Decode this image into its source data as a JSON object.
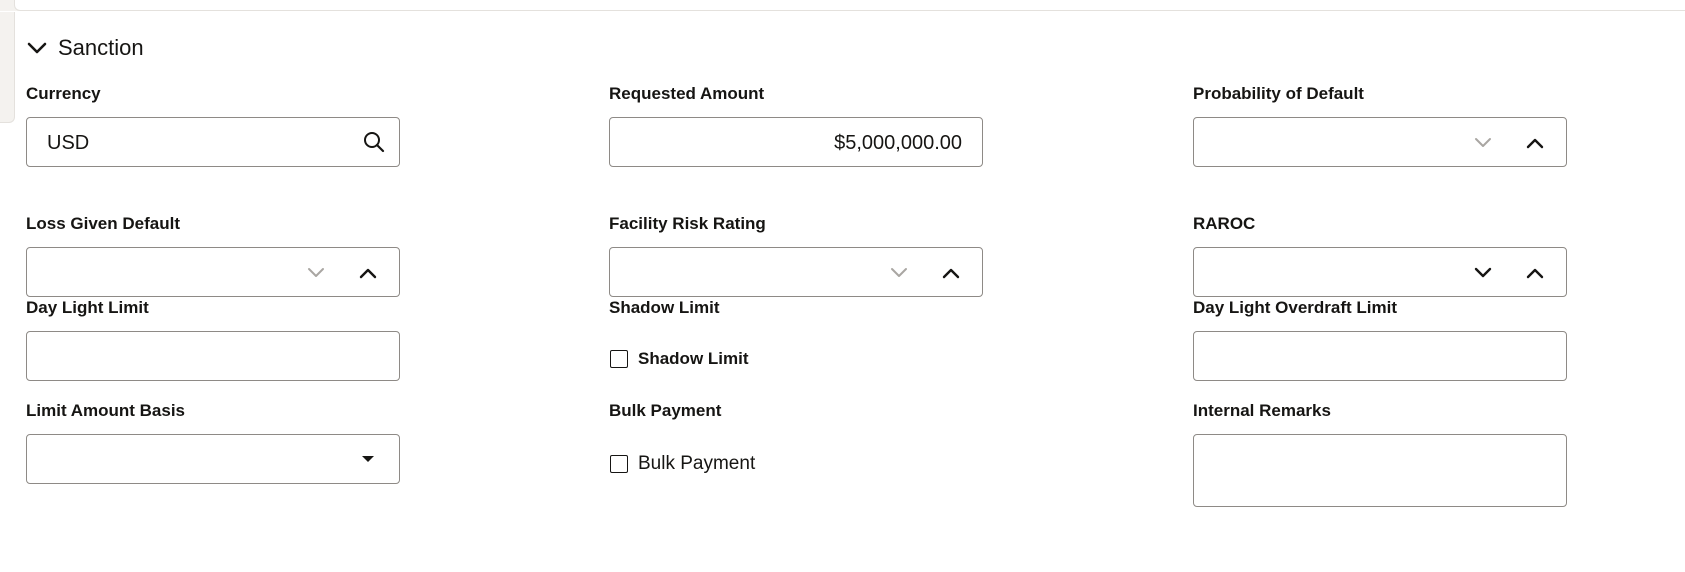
{
  "section": {
    "title": "Sanction",
    "expanded": true,
    "icon": "chevron-down-icon"
  },
  "fields": {
    "currency": {
      "label": "Currency",
      "value": "USD",
      "icon": "search-icon"
    },
    "requested_amount": {
      "label": "Requested Amount",
      "value": "$5,000,000.00"
    },
    "probability_of_default": {
      "label": "Probability of Default",
      "value": ""
    },
    "loss_given_default": {
      "label": "Loss Given Default",
      "value": ""
    },
    "facility_risk_rating": {
      "label": "Facility Risk Rating",
      "value": ""
    },
    "raroc": {
      "label": "RAROC",
      "value": ""
    },
    "day_light_limit": {
      "label": "Day Light Limit",
      "value": ""
    },
    "shadow_limit": {
      "label": "Shadow Limit",
      "checkbox_label": "Shadow Limit",
      "checked": false
    },
    "day_light_overdraft_limit": {
      "label": "Day Light Overdraft Limit",
      "value": ""
    },
    "limit_amount_basis": {
      "label": "Limit Amount Basis",
      "value": "",
      "icon": "dropdown-caret-icon"
    },
    "bulk_payment": {
      "label": "Bulk Payment",
      "checkbox_label": "Bulk Payment",
      "checked": false
    },
    "internal_remarks": {
      "label": "Internal Remarks",
      "value": ""
    }
  },
  "colors": {
    "text": "#161513",
    "border": "#8e8a86",
    "disabled_icon": "#a9a6a2",
    "background": "#ffffff"
  }
}
